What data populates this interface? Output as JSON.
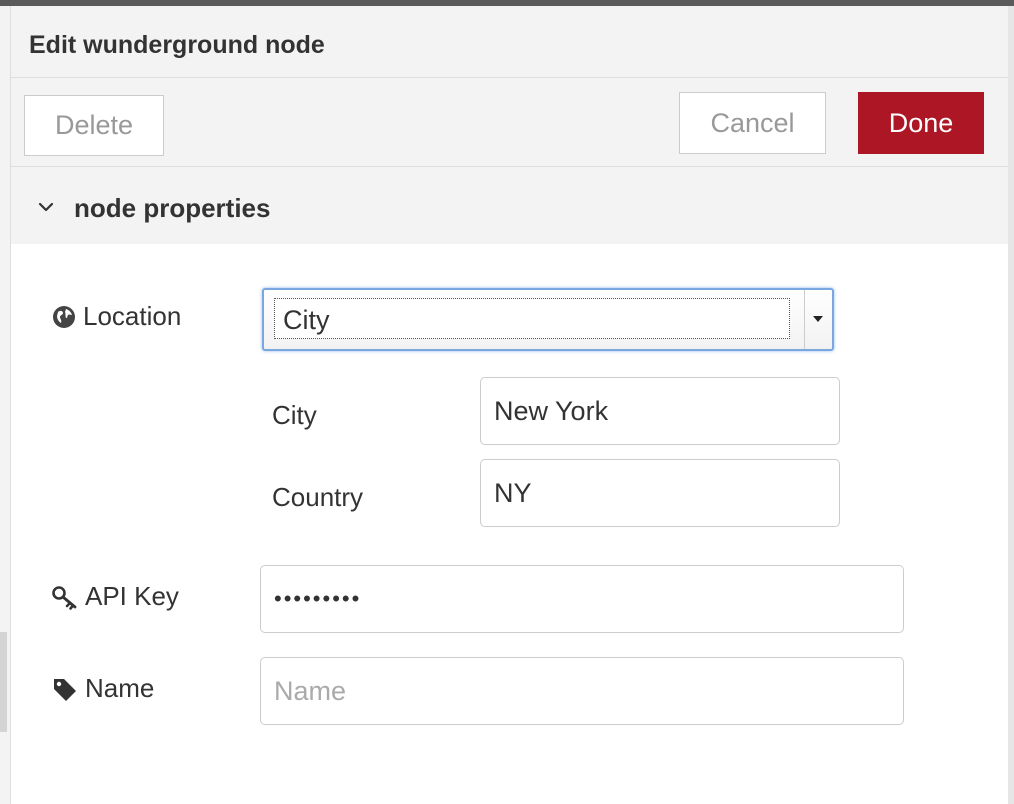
{
  "tray": {
    "title": "Edit wunderground node"
  },
  "toolbar": {
    "delete_label": "Delete",
    "cancel_label": "Cancel",
    "done_label": "Done"
  },
  "section": {
    "title": "node properties",
    "expanded": true,
    "icon": "chevron-down-icon"
  },
  "form": {
    "location": {
      "label": "Location",
      "icon": "globe-icon",
      "selected": "City"
    },
    "city": {
      "label": "City",
      "value": "New York"
    },
    "country": {
      "label": "Country",
      "value": "NY"
    },
    "apikey": {
      "label": "API Key",
      "icon": "key-icon",
      "value": "•••••••••"
    },
    "name": {
      "label": "Name",
      "icon": "tag-icon",
      "value": "",
      "placeholder": "Name"
    }
  },
  "colors": {
    "done_button": "#ad1625",
    "header_bg": "#f3f3f3",
    "focus_border": "#7aa7e0"
  }
}
